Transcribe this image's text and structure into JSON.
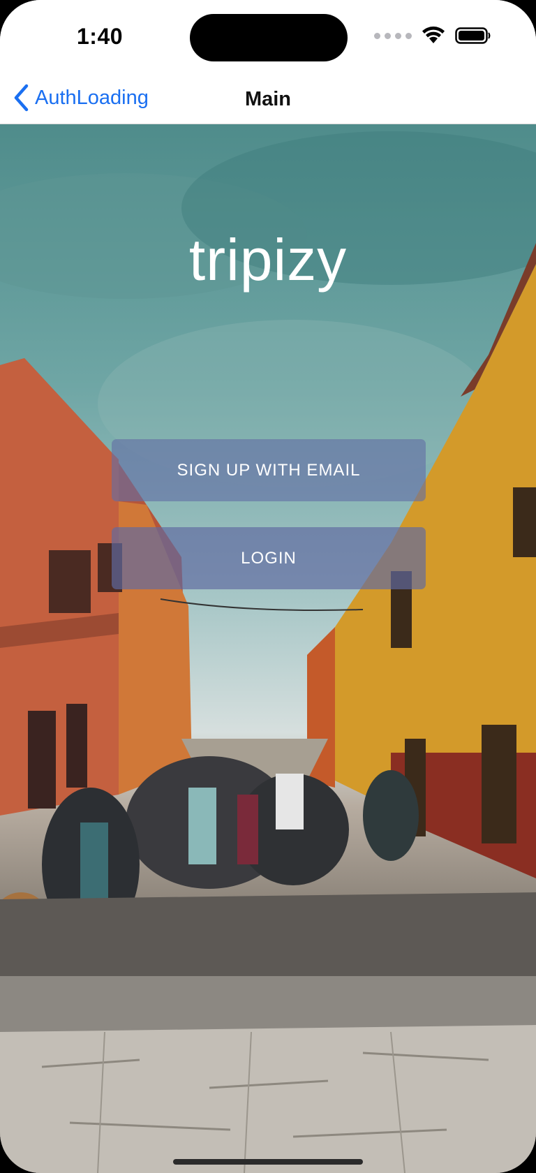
{
  "status_bar": {
    "time": "1:40",
    "icons": [
      "cellular-dots-icon",
      "wifi-icon",
      "battery-icon"
    ]
  },
  "nav": {
    "back_label": "AuthLoading",
    "title": "Main",
    "back_icon": "chevron-left-icon"
  },
  "hero": {
    "logo_text": "tripizy",
    "signup_label": "SIGN UP WITH EMAIL",
    "login_label": "LOGIN"
  },
  "colors": {
    "accent": "#1a6ff1",
    "button_bg": "#626ea5"
  }
}
